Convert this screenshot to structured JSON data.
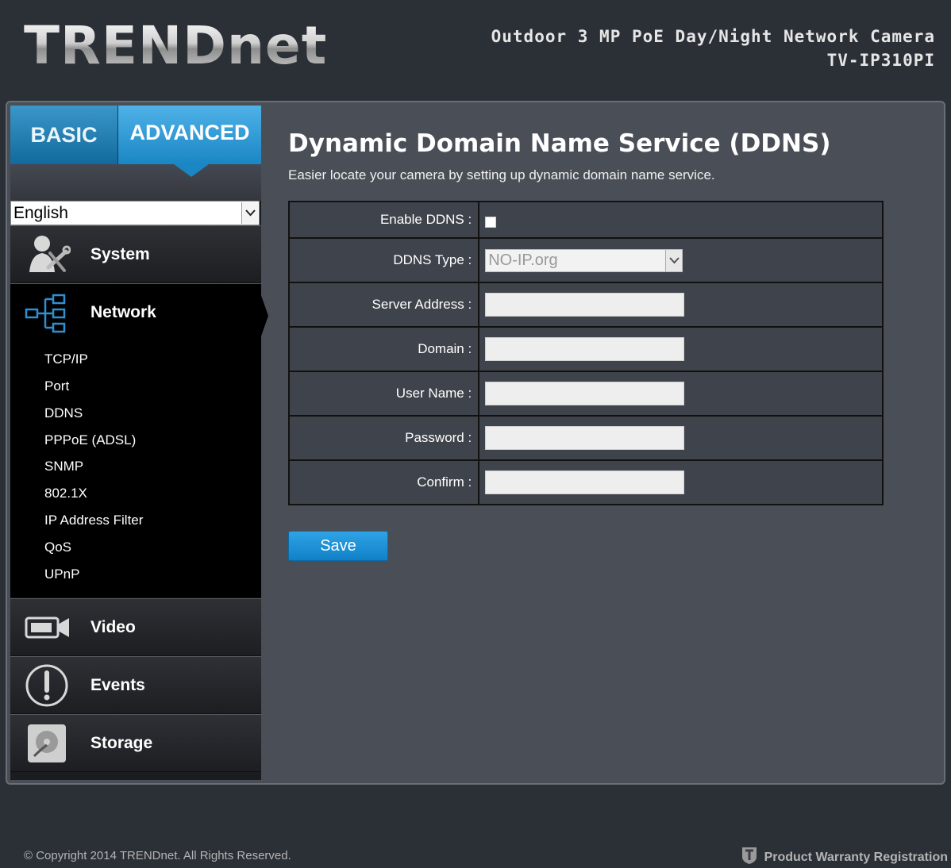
{
  "header": {
    "brand": "TRENDnet",
    "product_name": "Outdoor 3 MP PoE Day/Night Network Camera",
    "product_model": "TV-IP310PI"
  },
  "mode_tabs": {
    "basic": "BASIC",
    "advanced": "ADVANCED",
    "active": "ADVANCED"
  },
  "language": {
    "selected": "English"
  },
  "nav": {
    "system": "System",
    "network": "Network",
    "network_items": [
      "TCP/IP",
      "Port",
      "DDNS",
      "PPPoE (ADSL)",
      "SNMP",
      "802.1X",
      "IP Address Filter",
      "QoS",
      "UPnP"
    ],
    "video": "Video",
    "events": "Events",
    "storage": "Storage"
  },
  "page": {
    "title": "Dynamic Domain Name Service (DDNS)",
    "subtitle": "Easier locate your camera by setting up dynamic domain name service."
  },
  "form": {
    "enable_ddns_label": "Enable DDNS :",
    "enable_ddns_checked": false,
    "ddns_type_label": "DDNS Type :",
    "ddns_type_value": "NO-IP.org",
    "server_address_label": "Server Address :",
    "server_address_value": "",
    "domain_label": "Domain :",
    "domain_value": "",
    "user_name_label": "User Name :",
    "user_name_value": "",
    "password_label": "Password :",
    "password_value": "",
    "confirm_label": "Confirm :",
    "confirm_value": ""
  },
  "actions": {
    "save_label": "Save"
  },
  "footer": {
    "copyright": "© Copyright 2014 TRENDnet. All Rights Reserved.",
    "warranty": "Product Warranty Registration"
  },
  "colors": {
    "background": "#2b2f36",
    "panel": "#4a4e57",
    "accent_blue": "#1a86c4",
    "sidebar": "#1b1c1f"
  }
}
